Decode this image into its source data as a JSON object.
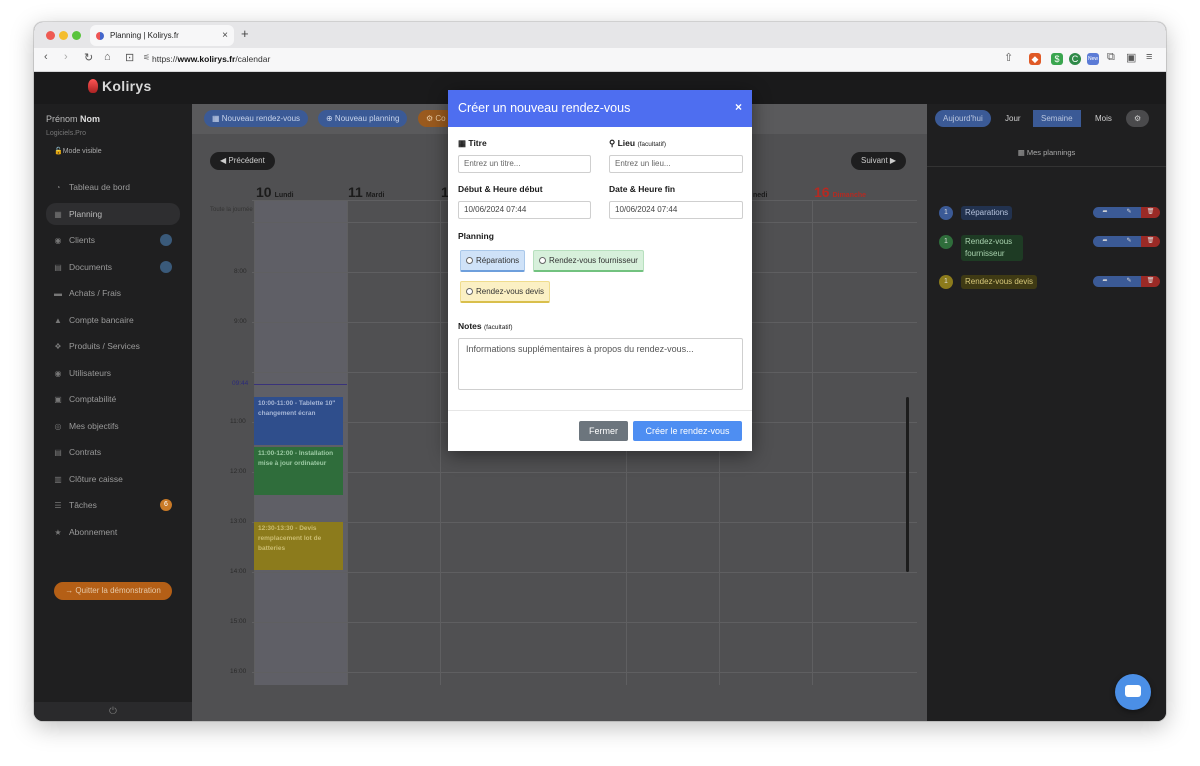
{
  "browser": {
    "tab_title": "Planning | Kolirys.fr",
    "tab_close": "×",
    "new_tab": "+",
    "url_prefix": "https://",
    "url_host": "www.kolirys.fr",
    "url_path": "/calendar",
    "ext_badge_new": "New"
  },
  "app": {
    "brand": "Kolirys",
    "user_first": "Prénom",
    "user_last": "Nom",
    "user_role": "Logiciels.Pro",
    "visible_mode": "Mode visible",
    "power_icon": "⏻"
  },
  "sidebar": {
    "items": [
      {
        "label": "Tableau de bord",
        "icon": "◔"
      },
      {
        "label": "Planning",
        "icon": "▦"
      },
      {
        "label": "Clients",
        "icon": "◉"
      },
      {
        "label": "Documents",
        "icon": "▤"
      },
      {
        "label": "Achats / Frais",
        "icon": "▬"
      },
      {
        "label": "Compte bancaire",
        "icon": "▲"
      },
      {
        "label": "Produits / Services",
        "icon": "❖"
      },
      {
        "label": "Utilisateurs",
        "icon": "◉"
      },
      {
        "label": "Comptabilité",
        "icon": "▣"
      },
      {
        "label": "Mes objectifs",
        "icon": "◎"
      },
      {
        "label": "Contrats",
        "icon": "▤"
      },
      {
        "label": "Clôture caisse",
        "icon": "▥"
      },
      {
        "label": "Tâches",
        "icon": "☰",
        "badge": "6"
      },
      {
        "label": "Abonnement",
        "icon": "★"
      }
    ],
    "quit_label": "→ Quitter la démonstration"
  },
  "toolbar": {
    "new_appointment": "▦ Nouveau rendez-vous",
    "new_planning": "⊕ Nouveau planning",
    "third_button": "⚙ Co"
  },
  "calendar": {
    "prev": "◀ Précédent",
    "next": "Suivant ▶",
    "days": [
      {
        "num": "10",
        "name": "Lundi"
      },
      {
        "num": "11",
        "name": "Mardi"
      },
      {
        "num": "1",
        "name": ""
      },
      {
        "num": "",
        "name": "nedi"
      },
      {
        "num": "16",
        "name": "Dimanche"
      }
    ],
    "allday": "Toute la journée",
    "hours": [
      "8:00",
      "9:00",
      "11:00",
      "12:00",
      "13:00",
      "14:00",
      "15:00",
      "16:00"
    ],
    "now_label": "09:44",
    "events": [
      {
        "text": "10:00-11:00 - Tablette 10\" changement écran"
      },
      {
        "text": "11:00-12:00 - Installation mise à jour ordinateur"
      },
      {
        "text": "12:30-13:30 - Devis remplacement lot de batteries"
      }
    ]
  },
  "right_panel": {
    "today": "Aujourd'hui",
    "views": [
      "Jour",
      "Semaine",
      "Mois"
    ],
    "settings_icon": "⚙",
    "title": "▦ Mes plannings",
    "calendars": [
      {
        "count": "1",
        "name": "Réparations",
        "color": "#3b5a96",
        "text_color": "#b6c3dd"
      },
      {
        "count": "1",
        "name": "Rendez-vous fournisseur",
        "color": "#2f6d3b",
        "text_color": "#a8d2ae"
      },
      {
        "count": "1",
        "name": "Rendez-vous devis",
        "color": "#8c7b1c",
        "text_color": "#d8c97a"
      }
    ],
    "actions": {
      "share": "➦",
      "edit": "✎",
      "delete": "🗑"
    }
  },
  "modal": {
    "title": "Créer un nouveau rendez-vous",
    "close": "×",
    "title_label": "Titre",
    "title_placeholder": "Entrez un titre...",
    "place_label": "Lieu",
    "place_optional": "(facultatif)",
    "place_placeholder": "Entrez un lieu...",
    "start_label": "Début & Heure début",
    "start_value": "10/06/2024 07:44",
    "end_label": "Date & Heure fin",
    "end_value": "10/06/2024 07:44",
    "planning_label": "Planning",
    "planning_options": [
      "Réparations",
      "Rendez-vous fournisseur",
      "Rendez-vous devis"
    ],
    "notes_label": "Notes",
    "notes_optional": "(facultatif)",
    "notes_placeholder": "Informations supplémentaires à propos du rendez-vous...",
    "close_button": "Fermer",
    "create_button": "Créer le rendez-vous"
  }
}
